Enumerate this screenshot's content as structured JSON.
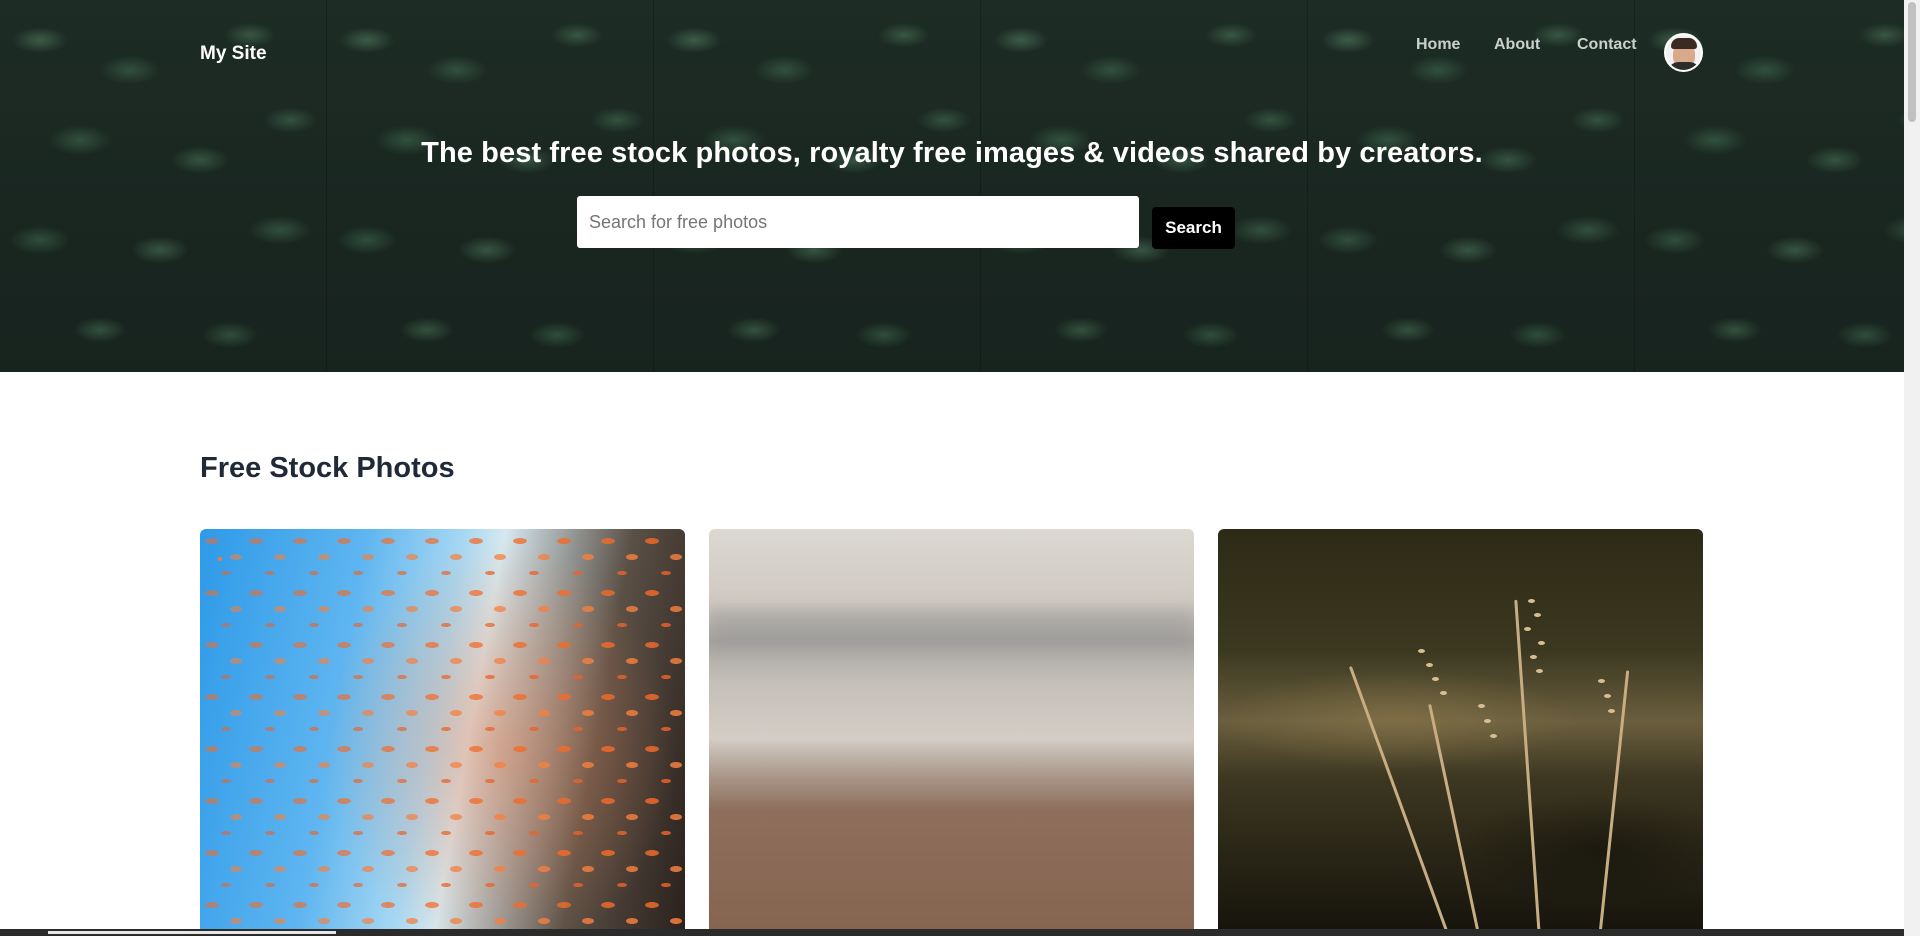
{
  "header": {
    "logo": "My Site",
    "nav": [
      {
        "label": "Home"
      },
      {
        "label": "About"
      },
      {
        "label": "Contact"
      }
    ]
  },
  "hero": {
    "title": "The best free stock photos, royalty free images & videos shared by creators.",
    "search_placeholder": "Search for free photos",
    "search_button": "Search"
  },
  "main": {
    "section_title": "Free Stock Photos"
  }
}
